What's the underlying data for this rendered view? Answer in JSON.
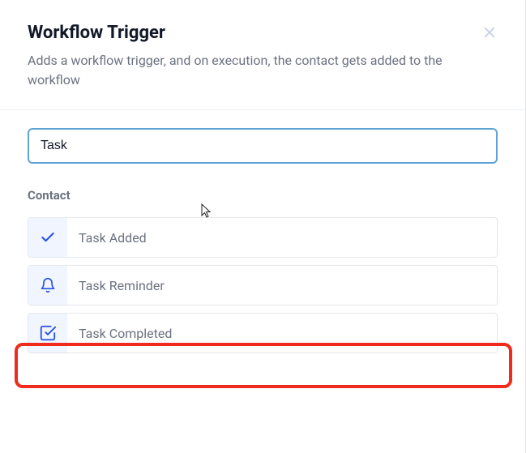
{
  "header": {
    "title": "Workflow Trigger",
    "description": "Adds a workflow trigger, and on execution, the contact gets added to the workflow"
  },
  "search": {
    "value": "Task",
    "placeholder": ""
  },
  "section": {
    "label": "Contact"
  },
  "options": [
    {
      "icon": "check-icon",
      "label": "Task Added"
    },
    {
      "icon": "bell-icon",
      "label": "Task Reminder"
    },
    {
      "icon": "checkbox-checked-icon",
      "label": "Task Completed"
    }
  ]
}
